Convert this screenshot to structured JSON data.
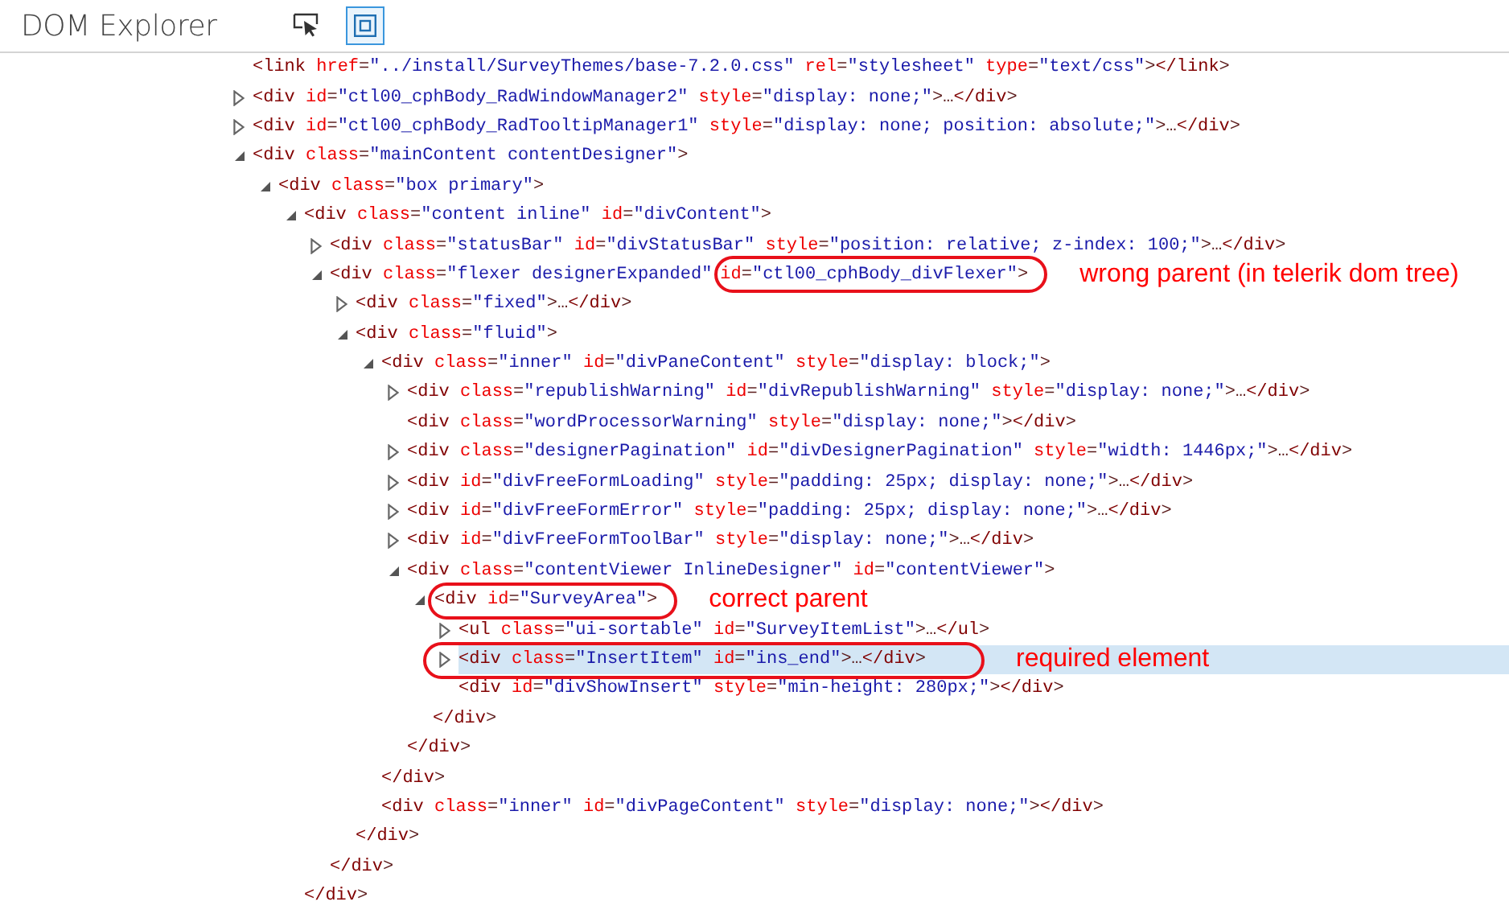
{
  "header": {
    "title": "DOM Explorer",
    "tools": [
      {
        "kind": "select-element",
        "selected": false
      },
      {
        "kind": "highlight",
        "selected": true
      }
    ]
  },
  "nodes": [
    {
      "text": "<link href=\"../install/SurveyThemes/base-7.2.0.css\" rel=\"stylesheet\" type=\"text/css\"></link>",
      "selected": false
    },
    {
      "text": "<div id=\"ctl00_cphBody_RadWindowManager2\" style=\"display: none;\">…</div>",
      "expanded": false,
      "selected": false
    },
    {
      "text": "<div id=\"ctl00_cphBody_RadTooltipManager1\" style=\"display: none; position: absolute;\">…</div>",
      "expanded": false,
      "selected": false
    },
    {
      "text": "<div class=\"mainContent contentDesigner\">",
      "expanded": true,
      "selected": false,
      "children": [
        {
          "text": "<div class=\"box primary\">",
          "expanded": true,
          "selected": false,
          "children": [
            {
              "text": "<div class=\"content inline\" id=\"divContent\">",
              "expanded": true,
              "selected": false,
              "closing": "</div>",
              "children": [
                {
                  "text": "<div class=\"statusBar\" id=\"divStatusBar\" style=\"position: relative; z-index: 100;\">…</div>",
                  "expanded": false,
                  "selected": false
                },
                {
                  "text": "<div class=\"flexer designerExpanded\" ",
                  "expanded": true,
                  "selected": false,
                  "closing": "</div>",
                  "note": {
                    "circled": "id=\"ctl00_cphBody_divFlexer\">",
                    "label": "wrong parent (in telerik dom tree)",
                    "includes_toggle": false
                  },
                  "children": [
                    {
                      "text": "<div class=\"fixed\">…</div>",
                      "expanded": false,
                      "selected": false
                    },
                    {
                      "text": "<div class=\"fluid\">",
                      "expanded": true,
                      "selected": false,
                      "closing": "</div>",
                      "children": [
                        {
                          "text": "<div class=\"inner\" id=\"divPaneContent\" style=\"display: block;\">",
                          "expanded": true,
                          "selected": false,
                          "closing": "</div>",
                          "children": [
                            {
                              "text": "<div class=\"republishWarning\" id=\"divRepublishWarning\" style=\"display: none;\">…</div>",
                              "expanded": false,
                              "selected": false
                            },
                            {
                              "text": "<div class=\"wordProcessorWarning\" style=\"display: none;\"></div>",
                              "selected": false
                            },
                            {
                              "text": "<div class=\"designerPagination\" id=\"divDesignerPagination\" style=\"width: 1446px;\">…</div>",
                              "expanded": false,
                              "selected": false
                            },
                            {
                              "text": "<div id=\"divFreeFormLoading\" style=\"padding: 25px; display: none;\">…</div>",
                              "expanded": false,
                              "selected": false
                            },
                            {
                              "text": "<div id=\"divFreeFormError\" style=\"padding: 25px; display: none;\">…</div>",
                              "expanded": false,
                              "selected": false
                            },
                            {
                              "text": "<div id=\"divFreeFormToolBar\" style=\"display: none;\">…</div>",
                              "expanded": false,
                              "selected": false
                            },
                            {
                              "text": "<div class=\"contentViewer InlineDesigner\" id=\"contentViewer\">",
                              "expanded": true,
                              "selected": false,
                              "closing": "</div>",
                              "children": [
                                {
                                  "expanded": true,
                                  "selected": false,
                                  "closing": "</div>",
                                  "note": {
                                    "circled": "<div id=\"SurveyArea\">",
                                    "label": "correct parent",
                                    "includes_toggle": false
                                  },
                                  "children": [
                                    {
                                      "text": "<ul class=\"ui-sortable\" id=\"SurveyItemList\">…</ul>",
                                      "expanded": false,
                                      "selected": false
                                    },
                                    {
                                      "expanded": false,
                                      "selected": true,
                                      "note": {
                                        "circled": "<div class=\"InsertItem\" id=\"ins_end\">…</div>",
                                        "label": "required element",
                                        "includes_toggle": true
                                      }
                                    },
                                    {
                                      "text": "<div id=\"divShowInsert\" style=\"min-height: 280px;\"></div>",
                                      "selected": false
                                    }
                                  ]
                                }
                              ]
                            }
                          ]
                        },
                        {
                          "text": "<div class=\"inner\" id=\"divPageContent\" style=\"display: none;\"></div>",
                          "selected": false
                        }
                      ]
                    }
                  ]
                }
              ]
            }
          ]
        }
      ]
    }
  ]
}
